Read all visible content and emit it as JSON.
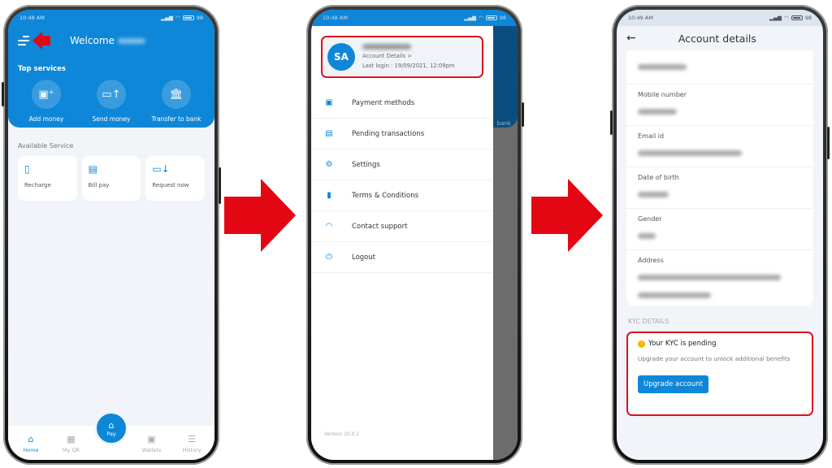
{
  "phone1": {
    "status_time": "10:48 AM",
    "battery": "98",
    "welcome": "Welcome",
    "top_services_title": "Top services",
    "top_services": [
      {
        "label": "Add money",
        "icon": "wallet-add-icon"
      },
      {
        "label": "Send money",
        "icon": "send-money-icon"
      },
      {
        "label": "Transfer to bank",
        "icon": "bank-icon"
      }
    ],
    "available_title": "Available Service",
    "available": [
      {
        "label": "Recharge",
        "icon": "phone-recharge-icon"
      },
      {
        "label": "Bill pay",
        "icon": "bill-icon"
      },
      {
        "label": "Request now",
        "icon": "request-money-icon"
      }
    ],
    "nav": [
      {
        "label": "Home",
        "active": true
      },
      {
        "label": "My QR"
      },
      {
        "label": "Pay"
      },
      {
        "label": "Wallets"
      },
      {
        "label": "History"
      }
    ]
  },
  "phone2": {
    "status_time": "10:48 AM",
    "battery": "98",
    "avatar_initials": "SA",
    "account_details_link": "Account Details  >",
    "last_login": "Last login : 19/09/2021, 12:09pm",
    "menu": [
      {
        "label": "Payment methods",
        "icon": "payment-card-icon"
      },
      {
        "label": "Pending transactions",
        "icon": "pending-doc-icon"
      },
      {
        "label": "Settings",
        "icon": "gear-icon"
      },
      {
        "label": "Terms & Conditions",
        "icon": "document-icon"
      },
      {
        "label": "Contact support",
        "icon": "headset-icon"
      },
      {
        "label": "Logout",
        "icon": "power-icon"
      }
    ],
    "version": "Version 10.0.1",
    "background_label": "bank"
  },
  "phone3": {
    "status_time": "10:49 AM",
    "battery": "98",
    "title": "Account details",
    "fields": [
      {
        "label": ""
      },
      {
        "label": "Mobile number"
      },
      {
        "label": "Email id"
      },
      {
        "label": "Date of birth"
      },
      {
        "label": "Gender"
      },
      {
        "label": "Address"
      }
    ],
    "kyc_section_title": "KYC DETAILS",
    "kyc_status": "Your KYC is pending",
    "kyc_description": "Upgrade your account to unlock additional benefits",
    "upgrade_button": "Upgrade account"
  },
  "colors": {
    "primary": "#0f87d8",
    "highlight": "#e0101e",
    "warning": "#f4b400"
  }
}
